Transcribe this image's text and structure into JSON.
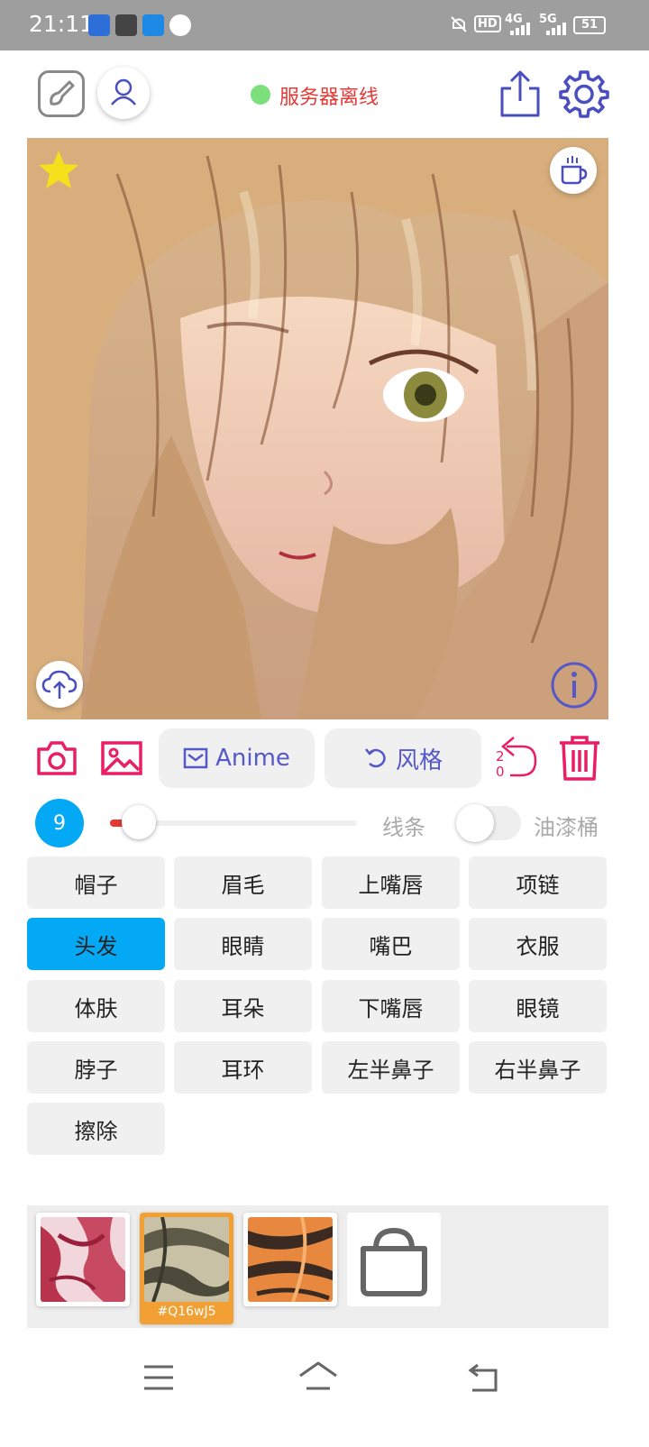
{
  "status_bar": {
    "time": "21:11",
    "signal_4g": "4G",
    "signal_5g": "5G",
    "hd": "HD",
    "battery": "51"
  },
  "header": {
    "server_status": "服务器离线",
    "server_status_color": "#e53935",
    "online_dot_color": "#7be07b"
  },
  "toolbar": {
    "anime_label": "Anime",
    "style_label": "风格",
    "undo_counter_top": "2",
    "undo_counter_bottom": "0",
    "accent_color": "#e91e63",
    "pill_text_color": "#5558c8"
  },
  "brush": {
    "size": "9",
    "size_fraction": 0.1,
    "line_label": "线条",
    "bucket_label": "油漆桶",
    "bucket_enabled": false
  },
  "parts": [
    {
      "label": "帽子",
      "selected": false
    },
    {
      "label": "眉毛",
      "selected": false
    },
    {
      "label": "上嘴唇",
      "selected": false
    },
    {
      "label": "项链",
      "selected": false
    },
    {
      "label": "头发",
      "selected": true
    },
    {
      "label": "眼睛",
      "selected": false
    },
    {
      "label": "嘴巴",
      "selected": false
    },
    {
      "label": "衣服",
      "selected": false
    },
    {
      "label": "体肤",
      "selected": false
    },
    {
      "label": "耳朵",
      "selected": false
    },
    {
      "label": "下嘴唇",
      "selected": false
    },
    {
      "label": "眼镜",
      "selected": false
    },
    {
      "label": "脖子",
      "selected": false
    },
    {
      "label": "耳环",
      "selected": false
    },
    {
      "label": "左半鼻子",
      "selected": false
    },
    {
      "label": "右半鼻子",
      "selected": false
    },
    {
      "label": "擦除",
      "selected": false
    }
  ],
  "styles": [
    {
      "code": "",
      "selected": false
    },
    {
      "code": "#Q16wJ5",
      "selected": true
    },
    {
      "code": "",
      "selected": false
    }
  ],
  "selected_color": "#03a9f4"
}
